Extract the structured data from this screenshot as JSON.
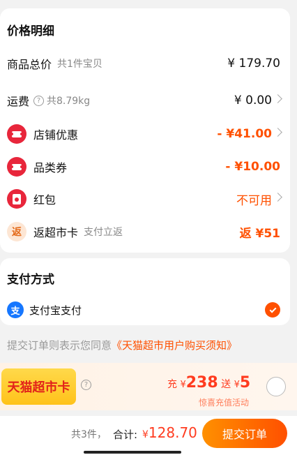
{
  "price_detail": {
    "title": "价格明细",
    "goods_total": {
      "label": "商品总价",
      "sub": "共1件宝贝",
      "value": "¥ 179.70"
    },
    "shipping": {
      "label": "运费",
      "sub": "共8.79kg",
      "value": "¥ 0.00"
    },
    "shop_discount": {
      "label": "店铺优惠",
      "value": "- ¥41.00"
    },
    "category_coupon": {
      "label": "品类券",
      "value": "- ¥10.00"
    },
    "red_packet": {
      "label": "红包",
      "value": "不可用"
    },
    "supermarket_card": {
      "icon_char": "返",
      "label": "返超市卡",
      "sub": "支付立返",
      "value": "返 ¥51"
    }
  },
  "payment": {
    "title": "支付方式",
    "method": {
      "icon_char": "支",
      "label": "支付宝支付"
    }
  },
  "agreement": {
    "prefix": "提交订单则表示您同意",
    "link": "《天猫超市用户购买须知》"
  },
  "promo": {
    "badge": "天猫超市卡",
    "charge_label": "充",
    "currency": "¥",
    "charge_amount": "238",
    "gift_label": "送",
    "gift_amount": "5",
    "sub": "惊喜充值活动"
  },
  "bottom": {
    "count": "共3件，",
    "total_label": "合计:",
    "currency": "¥",
    "total_amount": "128.70",
    "submit": "提交订单"
  },
  "colors": {
    "accent": "#ff5000",
    "coupon_red": "#e8263b",
    "alipay_blue": "#1677ff",
    "badge_yellow": "#ffc21a"
  }
}
